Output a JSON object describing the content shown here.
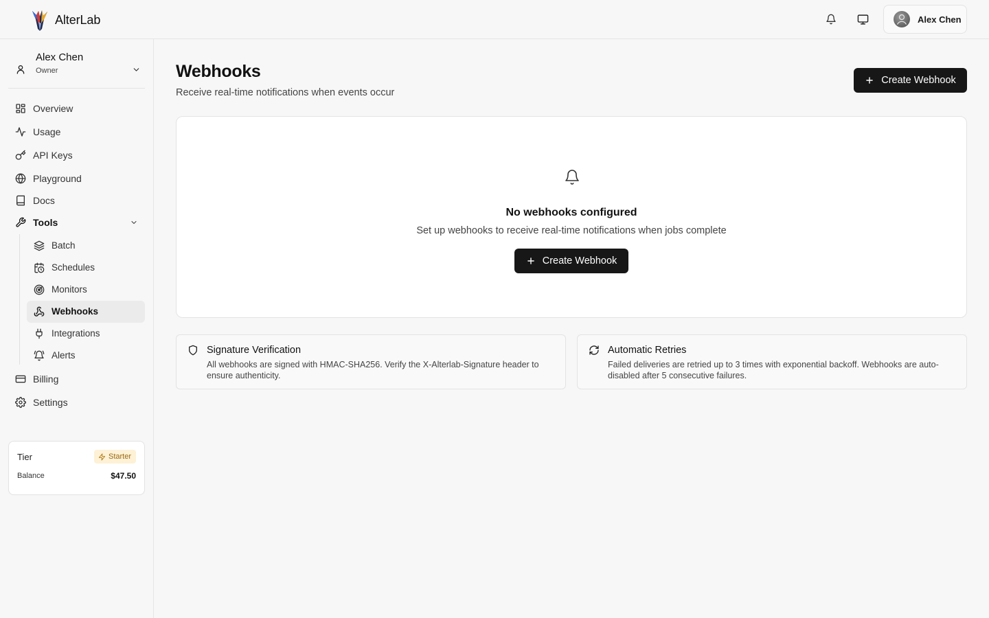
{
  "brand": {
    "name": "AlterLab"
  },
  "topbar": {
    "user_name": "Alex Chen",
    "icons": [
      "bell-icon",
      "monitor-icon"
    ]
  },
  "sidebar": {
    "account": {
      "name": "Alex Chen",
      "role": "Owner"
    },
    "nav": [
      {
        "label": "Overview",
        "icon": "grid-icon"
      },
      {
        "label": "Usage",
        "icon": "activity-icon"
      },
      {
        "label": "API Keys",
        "icon": "key-icon"
      },
      {
        "label": "Playground",
        "icon": "globe-icon"
      },
      {
        "label": "Docs",
        "icon": "book-icon"
      },
      {
        "label": "Tools",
        "icon": "wrench-icon"
      }
    ],
    "tools": [
      {
        "label": "Batch",
        "icon": "layers-icon"
      },
      {
        "label": "Schedules",
        "icon": "calendar-clock-icon"
      },
      {
        "label": "Monitors",
        "icon": "radar-icon"
      },
      {
        "label": "Webhooks",
        "icon": "webhook-icon",
        "active": true
      },
      {
        "label": "Integrations",
        "icon": "plug-icon"
      },
      {
        "label": "Alerts",
        "icon": "bell-ring-icon"
      }
    ],
    "bottom_nav": [
      {
        "label": "Billing",
        "icon": "credit-card-icon"
      },
      {
        "label": "Settings",
        "icon": "gear-icon"
      }
    ],
    "tier": {
      "label": "Tier",
      "badge": "Starter",
      "balance_label": "Balance",
      "balance_value": "$47.50"
    }
  },
  "main": {
    "title": "Webhooks",
    "subtitle": "Receive real-time notifications when events occur",
    "create_button": "Create Webhook",
    "empty": {
      "title": "No webhooks configured",
      "subtitle": "Set up webhooks to receive real-time notifications when jobs complete",
      "button": "Create Webhook"
    },
    "info_cards": [
      {
        "title": "Signature Verification",
        "text": "All webhooks are signed with HMAC-SHA256. Verify the X-Alterlab-Signature header to ensure authenticity.",
        "icon": "shield-icon"
      },
      {
        "title": "Automatic Retries",
        "text": "Failed deliveries are retried up to 3 times with exponential backoff. Webhooks are auto-disabled after 5 consecutive failures.",
        "icon": "refresh-icon"
      }
    ]
  },
  "colors": {
    "accent_dark": "#171717",
    "tier_badge_bg": "#fdf1d6",
    "tier_badge_text": "#9a6a12"
  }
}
